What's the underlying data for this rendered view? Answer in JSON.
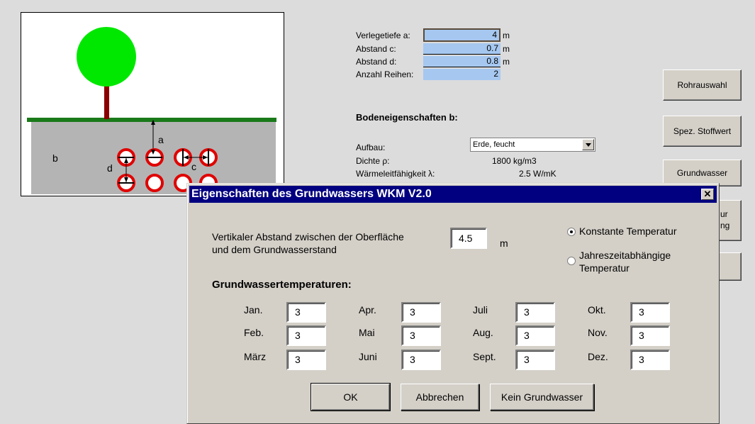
{
  "sheet": {
    "labels": {
      "verlegetiefe": "Verlegetiefe a:",
      "abstand_c": "Abstand c:",
      "abstand_d": "Abstand d:",
      "anzahl_reihen": "Anzahl Reihen:"
    },
    "values": {
      "verlegetiefe": "4",
      "abstand_c": "0.7",
      "abstand_d": "0.8",
      "anzahl_reihen": "2"
    },
    "unit_m": "m",
    "boden_title": "Bodeneigenschaften b:",
    "aufbau_label": "Aufbau:",
    "aufbau_value": "Erde, feucht",
    "dichte_label": "Dichte ρ:",
    "dichte_value": "1800 kg/m3",
    "waerme_label": "Wärmeleitfähigkeit λ:",
    "waerme_value": "2.5 W/mK",
    "buttons": {
      "rohrauswahl": "Rohrauswahl",
      "spez_stoffwert": "Spez. Stoffwert",
      "grundwasser": "Grundwasser",
      "partial_1": "ur",
      "partial_2": "ng"
    },
    "diagram_labels": {
      "a": "a",
      "b": "b",
      "c": "c",
      "d": "d"
    }
  },
  "dialog": {
    "title": "Eigenschaften des Grundwassers WKM V2.0",
    "close_glyph": "✕",
    "abstand_text_1": "Vertikaler Abstand zwischen der Oberfläche",
    "abstand_text_2": "und dem Grundwasserstand",
    "abstand_value": "4.5",
    "abstand_unit": "m",
    "radio_konstant": "Konstante Temperatur",
    "radio_jahres_1": "Jahreszeitabhängige",
    "radio_jahres_2": "Temperatur",
    "radio_selected": "konstant",
    "temps_heading": "Grundwassertemperaturen:",
    "months": [
      {
        "label": "Jan.",
        "value": "3"
      },
      {
        "label": "Feb.",
        "value": "3"
      },
      {
        "label": "März",
        "value": "3"
      },
      {
        "label": "Apr.",
        "value": "3"
      },
      {
        "label": "Mai",
        "value": "3"
      },
      {
        "label": "Juni",
        "value": "3"
      },
      {
        "label": "Juli",
        "value": "3"
      },
      {
        "label": "Aug.",
        "value": "3"
      },
      {
        "label": "Sept.",
        "value": "3"
      },
      {
        "label": "Okt.",
        "value": "3"
      },
      {
        "label": "Nov.",
        "value": "3"
      },
      {
        "label": "Dez.",
        "value": "3"
      }
    ],
    "buttons": {
      "ok": "OK",
      "abbrechen": "Abbrechen",
      "kein": "Kein Grundwasser"
    }
  },
  "colors": {
    "title_bar": "#000080",
    "field_blue": "#a6c8f0",
    "tree_green": "#00e800",
    "ground_green": "#1a7a1a",
    "trunk": "#8b0000",
    "soil": "#b4b4b4",
    "pipe_ring": "#e00000"
  }
}
